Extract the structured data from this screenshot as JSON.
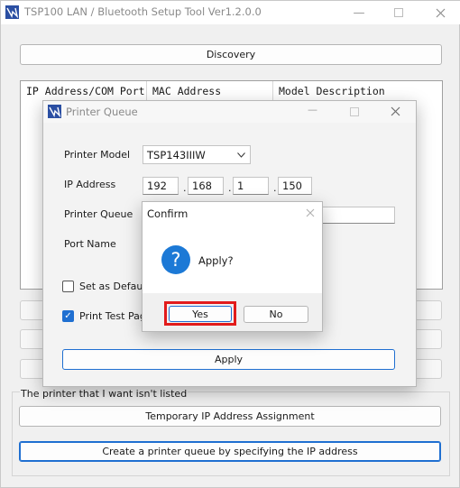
{
  "main_window": {
    "title": "TSP100 LAN / Bluetooth Setup Tool Ver1.2.0.0",
    "discovery_label": "Discovery",
    "columns": [
      "IP Address/COM Port",
      "MAC Address",
      "Model Description"
    ],
    "not_listed_text": "The printer that I want isn't listed",
    "temp_ip_label": "Temporary IP Address Assignment",
    "create_queue_label": "Create a printer queue by specifying the IP address"
  },
  "queue_dialog": {
    "title": "Printer Queue",
    "printer_model_label": "Printer Model",
    "printer_model_value": "TSP143IIIW",
    "ip_label": "IP Address",
    "ip_octets": [
      "192",
      "168",
      "1",
      "150"
    ],
    "ip_separator": ".",
    "printer_queue_label": "Printer Queue",
    "port_name_label": "Port Name",
    "default_label": "Set as Default",
    "print_test_label": "Print Test Page",
    "apply_label": "Apply"
  },
  "confirm_dialog": {
    "title": "Confirm",
    "message": "Apply?",
    "icon": "question-icon",
    "yes_label": "Yes",
    "no_label": "No"
  },
  "colors": {
    "accent": "#1f6fd1",
    "highlight": "#e21b1b",
    "question_icon": "#1c79d6"
  }
}
